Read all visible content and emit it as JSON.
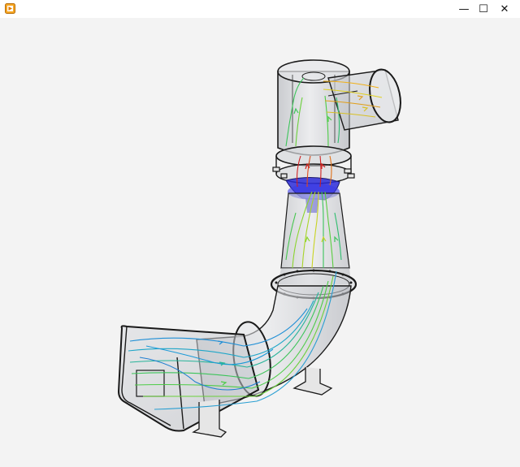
{
  "window": {
    "title": "",
    "icon": "app-icon",
    "controls": {
      "minimize_glyph": "—",
      "maximize_glyph": "☐",
      "close_glyph": "✕"
    }
  },
  "viewport": {
    "content": "cfd-flow-visualization",
    "colors": {
      "background": "#f3f3f3",
      "duct_fill": "#c9cbd0",
      "duct_edge": "#1a1a1a",
      "fan_blue": "#2a2ad8",
      "stream_low": "#1f8fd6",
      "stream_mid": "#3cc45a",
      "stream_high": "#e0d020",
      "stream_peak": "#d02020"
    }
  }
}
